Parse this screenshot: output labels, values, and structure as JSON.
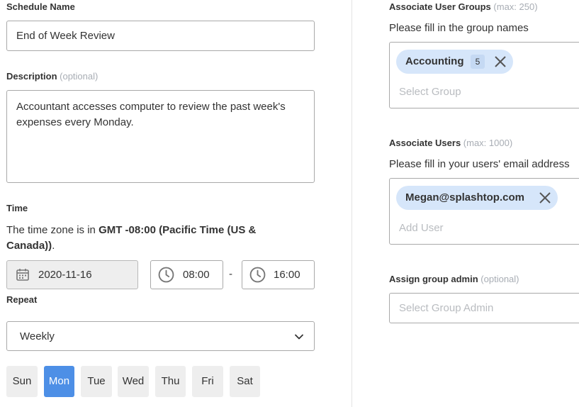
{
  "schedule_name": {
    "label": "Schedule Name",
    "value": "End of Week Review"
  },
  "description": {
    "label": "Description",
    "optional": "(optional)",
    "value": "Accountant accesses computer to review the past week's expenses every Monday."
  },
  "time": {
    "label": "Time",
    "timezone_prefix": "The time zone is in ",
    "timezone_value": "GMT -08:00 (Pacific Time (US & Canada))",
    "timezone_suffix": ".",
    "date": "2020-11-16",
    "start": "08:00",
    "separator": "-",
    "end": "16:00"
  },
  "repeat": {
    "label": "Repeat",
    "value": "Weekly"
  },
  "days": [
    {
      "label": "Sun",
      "active": false
    },
    {
      "label": "Mon",
      "active": true
    },
    {
      "label": "Tue",
      "active": false
    },
    {
      "label": "Wed",
      "active": false
    },
    {
      "label": "Thu",
      "active": false
    },
    {
      "label": "Fri",
      "active": false
    },
    {
      "label": "Sat",
      "active": false
    }
  ],
  "user_groups": {
    "label": "Associate User Groups",
    "max": "(max: 250)",
    "hint": "Please fill in the group names",
    "chip": {
      "name": "Accounting",
      "count": "5"
    },
    "placeholder": "Select Group"
  },
  "users": {
    "label": "Associate Users",
    "max": "(max: 1000)",
    "hint": "Please fill in your users' email address",
    "chip": {
      "email": "Megan@splashtop.com"
    },
    "placeholder": "Add User"
  },
  "group_admin": {
    "label": "Assign group admin",
    "optional": "(optional)",
    "placeholder": "Select Group Admin"
  },
  "colors": {
    "accent": "#4d8fe6",
    "chip_bg": "#d6e6fa",
    "border": "#a9a9a9"
  }
}
